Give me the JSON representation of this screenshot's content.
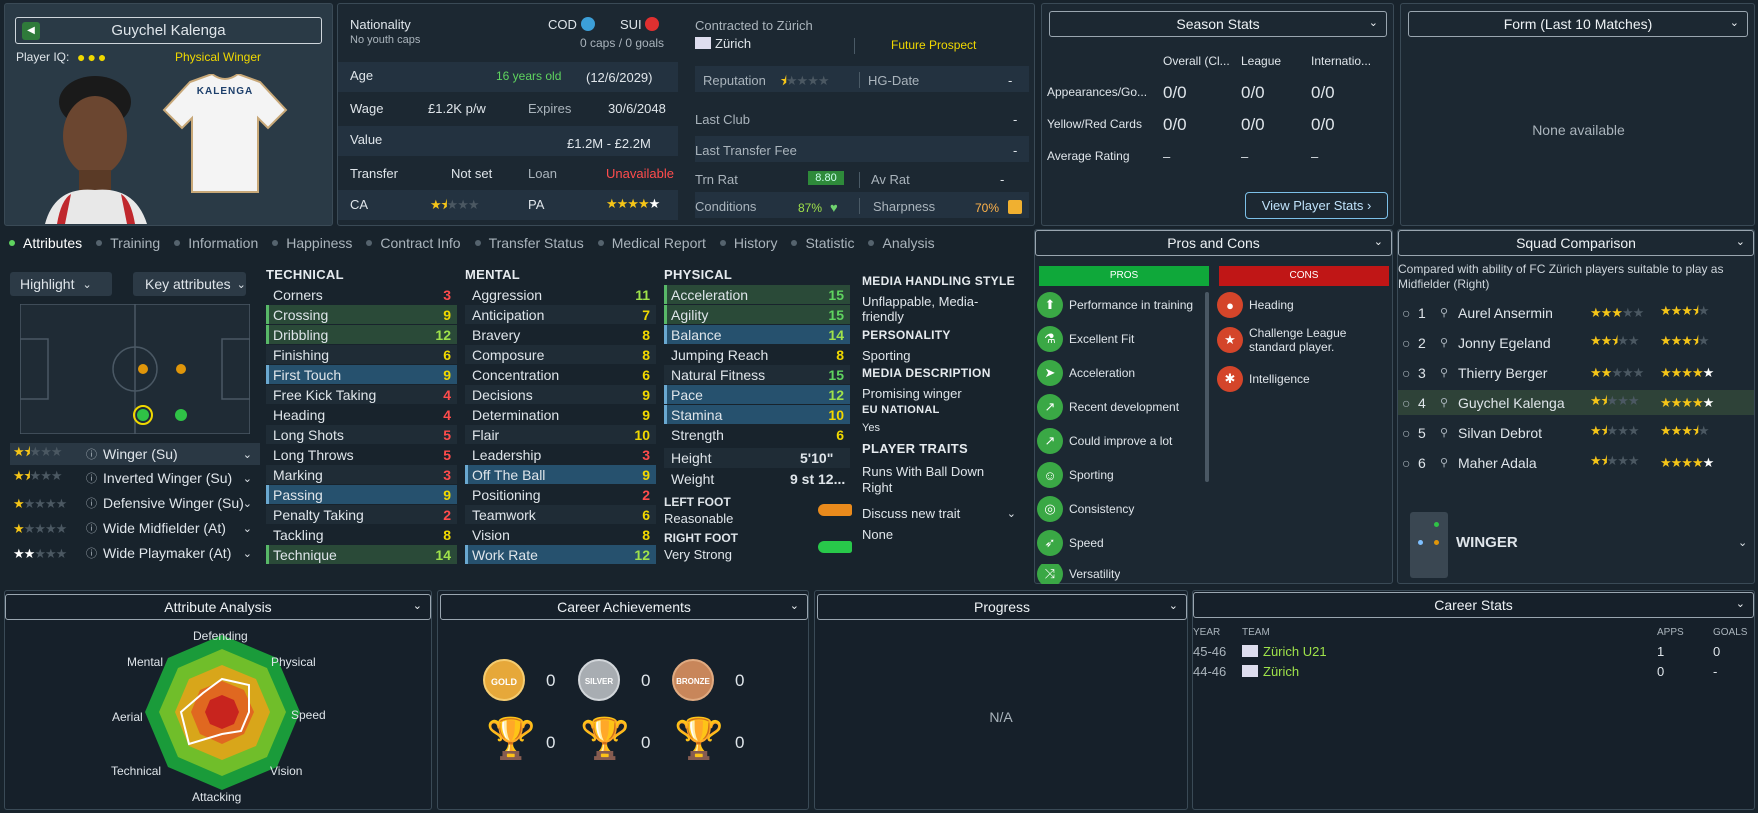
{
  "player": {
    "name": "Guychel Kalenga",
    "iq_label": "Player IQ:",
    "role": "Physical Winger",
    "shirt_name": "KALENGA"
  },
  "nationality": {
    "label": "Nationality",
    "sub": "No youth caps",
    "n1": "COD",
    "n2": "SUI",
    "caps": "0 caps / 0 goals"
  },
  "info": {
    "age_label": "Age",
    "age_val": "16 years old",
    "age_date": "(12/6/2029)",
    "wage_label": "Wage",
    "wage_val": "£1.2K p/w",
    "expires_label": "Expires",
    "expires_val": "30/6/2048",
    "value_label": "Value",
    "value_val": "£1.2M - £2.2M",
    "transfer_label": "Transfer",
    "transfer_val": "Not set",
    "loan_label": "Loan",
    "loan_val": "Unavailable",
    "ca_label": "CA",
    "pa_label": "PA",
    "ca_stars": 1.5,
    "pa_stars": 4.5
  },
  "contract": {
    "label": "Contracted to Zürich",
    "club": "Zürich",
    "status": "Future Prospect",
    "rep_label": "Reputation",
    "hg_label": "HG-Date",
    "hg_val": "-",
    "last_club_label": "Last Club",
    "last_club_val": "-",
    "fee_label": "Last Transfer Fee",
    "fee_val": "-",
    "trn_label": "Trn Rat",
    "trn_val": "8.80",
    "av_label": "Av Rat",
    "av_val": "-",
    "cond_label": "Conditions",
    "cond_val": "87%",
    "sharp_label": "Sharpness",
    "sharp_val": "70%"
  },
  "season": {
    "title": "Season Stats",
    "c1": "Overall (Cl...",
    "c2": "League",
    "c3": "Internatio...",
    "rows": [
      {
        "l": "Appearances/Go...",
        "a": "0/0",
        "b": "0/0",
        "c": "0/0"
      },
      {
        "l": "Yellow/Red Cards",
        "a": "0/0",
        "b": "0/0",
        "c": "0/0"
      },
      {
        "l": "Average Rating",
        "a": "–",
        "b": "–",
        "c": "–"
      }
    ],
    "button": "View Player Stats"
  },
  "form": {
    "title": "Form (Last 10 Matches)",
    "empty": "None available"
  },
  "tabs": [
    "Attributes",
    "Training",
    "Information",
    "Happiness",
    "Contract Info",
    "Transfer Status",
    "Medical Report",
    "History",
    "Statistic",
    "Analysis"
  ],
  "controls": {
    "highlight": "Highlight",
    "key": "Key attributes"
  },
  "roles": [
    {
      "name": "Winger (Su)",
      "stars": 1.5
    },
    {
      "name": "Inverted Winger (Su)",
      "stars": 1.5
    },
    {
      "name": "Defensive Winger (Su)",
      "stars": 1
    },
    {
      "name": "Wide Midfielder (At)",
      "stars": 1
    },
    {
      "name": "Wide Playmaker (At)",
      "stars": 2
    }
  ],
  "technical": {
    "title": "TECHNICAL",
    "items": [
      [
        "Corners",
        "3"
      ],
      [
        "Crossing",
        "9"
      ],
      [
        "Dribbling",
        "12"
      ],
      [
        "Finishing",
        "6"
      ],
      [
        "First Touch",
        "9"
      ],
      [
        "Free Kick Taking",
        "4"
      ],
      [
        "Heading",
        "4"
      ],
      [
        "Long Shots",
        "5"
      ],
      [
        "Long Throws",
        "5"
      ],
      [
        "Marking",
        "3"
      ],
      [
        "Passing",
        "9"
      ],
      [
        "Penalty Taking",
        "2"
      ],
      [
        "Tackling",
        "8"
      ],
      [
        "Technique",
        "14"
      ]
    ]
  },
  "mental": {
    "title": "MENTAL",
    "items": [
      [
        "Aggression",
        "11"
      ],
      [
        "Anticipation",
        "7"
      ],
      [
        "Bravery",
        "8"
      ],
      [
        "Composure",
        "8"
      ],
      [
        "Concentration",
        "6"
      ],
      [
        "Decisions",
        "9"
      ],
      [
        "Determination",
        "9"
      ],
      [
        "Flair",
        "10"
      ],
      [
        "Leadership",
        "3"
      ],
      [
        "Off The Ball",
        "9"
      ],
      [
        "Positioning",
        "2"
      ],
      [
        "Teamwork",
        "6"
      ],
      [
        "Vision",
        "8"
      ],
      [
        "Work Rate",
        "12"
      ]
    ]
  },
  "physical": {
    "title": "PHYSICAL",
    "items": [
      [
        "Acceleration",
        "15"
      ],
      [
        "Agility",
        "15"
      ],
      [
        "Balance",
        "14"
      ],
      [
        "Jumping Reach",
        "8"
      ],
      [
        "Natural Fitness",
        "15"
      ],
      [
        "Pace",
        "12"
      ],
      [
        "Stamina",
        "10"
      ],
      [
        "Strength",
        "6"
      ]
    ],
    "height_label": "Height",
    "height": "5'10\"",
    "weight_label": "Weight",
    "weight": "9 st 12...",
    "lf_label": "LEFT FOOT",
    "lf": "Reasonable",
    "rf_label": "RIGHT FOOT",
    "rf": "Very Strong"
  },
  "media": {
    "style_title": "MEDIA HANDLING STYLE",
    "style": "Unflappable, Media-friendly",
    "pers_title": "PERSONALITY",
    "pers": "Sporting",
    "desc_title": "MEDIA DESCRIPTION",
    "desc": "Promising winger",
    "eu_title": "EU NATIONAL",
    "eu": "Yes",
    "traits_title": "PLAYER TRAITS",
    "trait1": "Runs With Ball Down Right",
    "trait_btn": "Discuss new trait",
    "trait_none": "None"
  },
  "proscons": {
    "title": "Pros and Cons",
    "pros_label": "PROS",
    "cons_label": "CONS",
    "pros": [
      "Performance in training",
      "Excellent Fit",
      "Acceleration",
      "Recent development",
      "Could improve a lot",
      "Sporting",
      "Consistency",
      "Speed",
      "Versatility"
    ],
    "cons": [
      "Heading",
      "Challenge League standard player.",
      "Intelligence"
    ]
  },
  "squad": {
    "title": "Squad Comparison",
    "desc": "Compared with ability of FC Zürich players suitable to play as Midfielder (Right)",
    "rows": [
      {
        "n": "1",
        "name": "Aurel Ansermin",
        "ca": 3,
        "pa": 3.5
      },
      {
        "n": "2",
        "name": "Jonny Egeland",
        "ca": 2.5,
        "pa": 3.5
      },
      {
        "n": "3",
        "name": "Thierry Berger",
        "ca": 2,
        "pa": 4.5
      },
      {
        "n": "4",
        "name": "Guychel Kalenga",
        "ca": 1.5,
        "pa": 5
      },
      {
        "n": "5",
        "name": "Silvan Debrot",
        "ca": 1.5,
        "pa": 3.5
      },
      {
        "n": "6",
        "name": "Maher Adala",
        "ca": 1.5,
        "pa": 4.5
      }
    ],
    "position": "WINGER"
  },
  "analysis": {
    "title": "Attribute Analysis",
    "labels": [
      "Defending",
      "Physical",
      "Speed",
      "Vision",
      "Attacking",
      "Technical",
      "Aerial",
      "Mental"
    ]
  },
  "achievements": {
    "title": "Career Achievements",
    "gold": "GOLD",
    "silver": "SILVER",
    "bronze": "BRONZE",
    "g": "0",
    "s": "0",
    "b": "0",
    "t1": "0",
    "t2": "0",
    "t3": "0"
  },
  "progress": {
    "title": "Progress",
    "na": "N/A"
  },
  "career": {
    "title": "Career Stats",
    "h_year": "YEAR",
    "h_team": "TEAM",
    "h_apps": "APPS",
    "h_goals": "GOALS",
    "rows": [
      {
        "year": "45-46",
        "team": "Zürich U21",
        "apps": "1",
        "goals": "0"
      },
      {
        "year": "44-46",
        "team": "Zürich",
        "apps": "0",
        "goals": "-"
      }
    ]
  }
}
